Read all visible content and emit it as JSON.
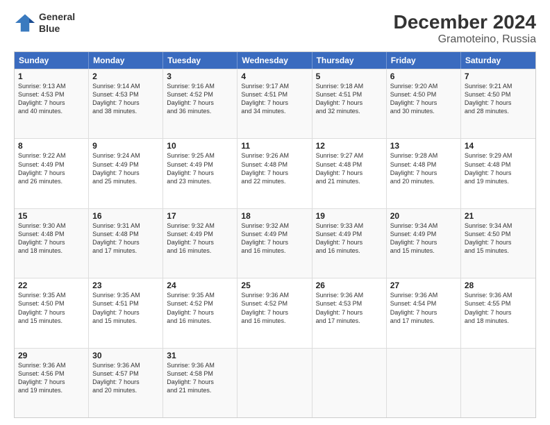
{
  "logo": {
    "line1": "General",
    "line2": "Blue"
  },
  "title": "December 2024",
  "subtitle": "Gramoteino, Russia",
  "headers": [
    "Sunday",
    "Monday",
    "Tuesday",
    "Wednesday",
    "Thursday",
    "Friday",
    "Saturday"
  ],
  "weeks": [
    [
      {
        "day": "1",
        "info": "Sunrise: 9:13 AM\nSunset: 4:53 PM\nDaylight: 7 hours\nand 40 minutes."
      },
      {
        "day": "2",
        "info": "Sunrise: 9:14 AM\nSunset: 4:53 PM\nDaylight: 7 hours\nand 38 minutes."
      },
      {
        "day": "3",
        "info": "Sunrise: 9:16 AM\nSunset: 4:52 PM\nDaylight: 7 hours\nand 36 minutes."
      },
      {
        "day": "4",
        "info": "Sunrise: 9:17 AM\nSunset: 4:51 PM\nDaylight: 7 hours\nand 34 minutes."
      },
      {
        "day": "5",
        "info": "Sunrise: 9:18 AM\nSunset: 4:51 PM\nDaylight: 7 hours\nand 32 minutes."
      },
      {
        "day": "6",
        "info": "Sunrise: 9:20 AM\nSunset: 4:50 PM\nDaylight: 7 hours\nand 30 minutes."
      },
      {
        "day": "7",
        "info": "Sunrise: 9:21 AM\nSunset: 4:50 PM\nDaylight: 7 hours\nand 28 minutes."
      }
    ],
    [
      {
        "day": "8",
        "info": "Sunrise: 9:22 AM\nSunset: 4:49 PM\nDaylight: 7 hours\nand 26 minutes."
      },
      {
        "day": "9",
        "info": "Sunrise: 9:24 AM\nSunset: 4:49 PM\nDaylight: 7 hours\nand 25 minutes."
      },
      {
        "day": "10",
        "info": "Sunrise: 9:25 AM\nSunset: 4:49 PM\nDaylight: 7 hours\nand 23 minutes."
      },
      {
        "day": "11",
        "info": "Sunrise: 9:26 AM\nSunset: 4:48 PM\nDaylight: 7 hours\nand 22 minutes."
      },
      {
        "day": "12",
        "info": "Sunrise: 9:27 AM\nSunset: 4:48 PM\nDaylight: 7 hours\nand 21 minutes."
      },
      {
        "day": "13",
        "info": "Sunrise: 9:28 AM\nSunset: 4:48 PM\nDaylight: 7 hours\nand 20 minutes."
      },
      {
        "day": "14",
        "info": "Sunrise: 9:29 AM\nSunset: 4:48 PM\nDaylight: 7 hours\nand 19 minutes."
      }
    ],
    [
      {
        "day": "15",
        "info": "Sunrise: 9:30 AM\nSunset: 4:48 PM\nDaylight: 7 hours\nand 18 minutes."
      },
      {
        "day": "16",
        "info": "Sunrise: 9:31 AM\nSunset: 4:48 PM\nDaylight: 7 hours\nand 17 minutes."
      },
      {
        "day": "17",
        "info": "Sunrise: 9:32 AM\nSunset: 4:49 PM\nDaylight: 7 hours\nand 16 minutes."
      },
      {
        "day": "18",
        "info": "Sunrise: 9:32 AM\nSunset: 4:49 PM\nDaylight: 7 hours\nand 16 minutes."
      },
      {
        "day": "19",
        "info": "Sunrise: 9:33 AM\nSunset: 4:49 PM\nDaylight: 7 hours\nand 16 minutes."
      },
      {
        "day": "20",
        "info": "Sunrise: 9:34 AM\nSunset: 4:49 PM\nDaylight: 7 hours\nand 15 minutes."
      },
      {
        "day": "21",
        "info": "Sunrise: 9:34 AM\nSunset: 4:50 PM\nDaylight: 7 hours\nand 15 minutes."
      }
    ],
    [
      {
        "day": "22",
        "info": "Sunrise: 9:35 AM\nSunset: 4:50 PM\nDaylight: 7 hours\nand 15 minutes."
      },
      {
        "day": "23",
        "info": "Sunrise: 9:35 AM\nSunset: 4:51 PM\nDaylight: 7 hours\nand 15 minutes."
      },
      {
        "day": "24",
        "info": "Sunrise: 9:35 AM\nSunset: 4:52 PM\nDaylight: 7 hours\nand 16 minutes."
      },
      {
        "day": "25",
        "info": "Sunrise: 9:36 AM\nSunset: 4:52 PM\nDaylight: 7 hours\nand 16 minutes."
      },
      {
        "day": "26",
        "info": "Sunrise: 9:36 AM\nSunset: 4:53 PM\nDaylight: 7 hours\nand 17 minutes."
      },
      {
        "day": "27",
        "info": "Sunrise: 9:36 AM\nSunset: 4:54 PM\nDaylight: 7 hours\nand 17 minutes."
      },
      {
        "day": "28",
        "info": "Sunrise: 9:36 AM\nSunset: 4:55 PM\nDaylight: 7 hours\nand 18 minutes."
      }
    ],
    [
      {
        "day": "29",
        "info": "Sunrise: 9:36 AM\nSunset: 4:56 PM\nDaylight: 7 hours\nand 19 minutes."
      },
      {
        "day": "30",
        "info": "Sunrise: 9:36 AM\nSunset: 4:57 PM\nDaylight: 7 hours\nand 20 minutes."
      },
      {
        "day": "31",
        "info": "Sunrise: 9:36 AM\nSunset: 4:58 PM\nDaylight: 7 hours\nand 21 minutes."
      },
      {
        "day": "",
        "info": ""
      },
      {
        "day": "",
        "info": ""
      },
      {
        "day": "",
        "info": ""
      },
      {
        "day": "",
        "info": ""
      }
    ]
  ]
}
